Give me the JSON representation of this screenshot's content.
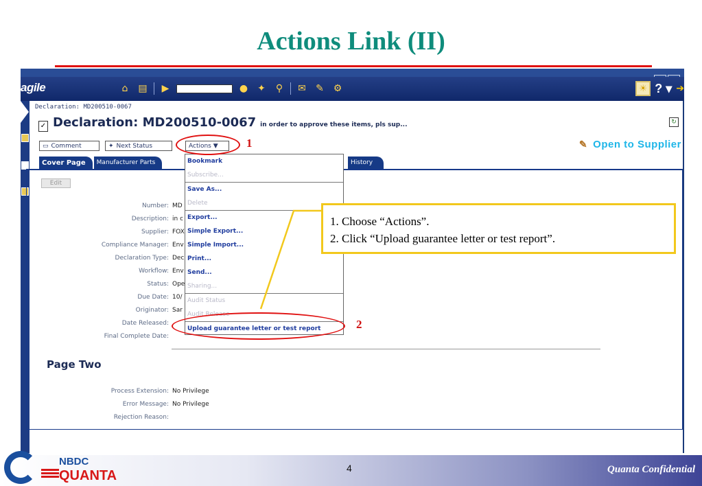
{
  "slide": {
    "title": "Actions Link (II)",
    "page_number": "4",
    "confidential": "Quanta Confidential",
    "logo_top": "NBDC",
    "logo_bottom": "QUANTA"
  },
  "app": {
    "brand": "agile",
    "breadcrumb": "Declaration: MD200510-0067",
    "declaration_title": "Declaration: MD200510-0067",
    "declaration_desc": "in order to approve these items, pls sup...",
    "buttons": {
      "comment": "Comment",
      "next_status": "Next Status",
      "actions": "Actions ▼"
    },
    "status_action": "Open to Supplier",
    "tabs": [
      "Cover Page",
      "Manufacturer Parts"
    ],
    "tab_history": "History",
    "edit": "Edit",
    "fields": [
      {
        "label": "Number:",
        "value": "MD"
      },
      {
        "label": "Description:",
        "value": "in c"
      },
      {
        "label": "Supplier:",
        "value": "FOX"
      },
      {
        "label": "Compliance Manager:",
        "value": "Env"
      },
      {
        "label": "Declaration Type:",
        "value": "Dec"
      },
      {
        "label": "Workflow:",
        "value": "Env"
      },
      {
        "label": "Status:",
        "value": "Ope"
      },
      {
        "label": "Due Date:",
        "value": "10/"
      },
      {
        "label": "Originator:",
        "value": "Sar"
      },
      {
        "label": "Date Released:",
        "value": ""
      },
      {
        "label": "Final Complete Date:",
        "value": ""
      }
    ],
    "page_two_title": "Page Two",
    "page_two_fields": [
      {
        "label": "Process Extension:",
        "value": "No Privilege"
      },
      {
        "label": "Error Message:",
        "value": "No Privilege"
      },
      {
        "label": "Rejection Reason:",
        "value": ""
      }
    ]
  },
  "menu": {
    "items": [
      {
        "label": "Bookmark",
        "enabled": true
      },
      {
        "label": "Subscribe...",
        "enabled": false
      },
      {
        "sep": true
      },
      {
        "label": "Save As...",
        "enabled": true
      },
      {
        "label": "Delete",
        "enabled": false
      },
      {
        "sep": true
      },
      {
        "label": "Export...",
        "enabled": true
      },
      {
        "label": "Simple Export...",
        "enabled": true
      },
      {
        "label": "Simple Import...",
        "enabled": true
      },
      {
        "label": "Print...",
        "enabled": true
      },
      {
        "label": "Send...",
        "enabled": true
      },
      {
        "label": "Sharing...",
        "enabled": false
      },
      {
        "sep": true
      },
      {
        "label": "Audit Status",
        "enabled": false
      },
      {
        "label": "Audit Release",
        "enabled": false
      },
      {
        "sep": true
      },
      {
        "label": "Upload guarantee letter or test report",
        "enabled": true
      }
    ]
  },
  "annotations": {
    "marker_1": "1",
    "marker_2": "2",
    "callout_line1": "1. Choose “Actions”.",
    "callout_line2": "2. Click “Upload guarantee letter or test report”.",
    "colors": {
      "ellipse": "#e01010",
      "callout_border": "#f2c81c",
      "title": "#0f8c7c"
    }
  }
}
